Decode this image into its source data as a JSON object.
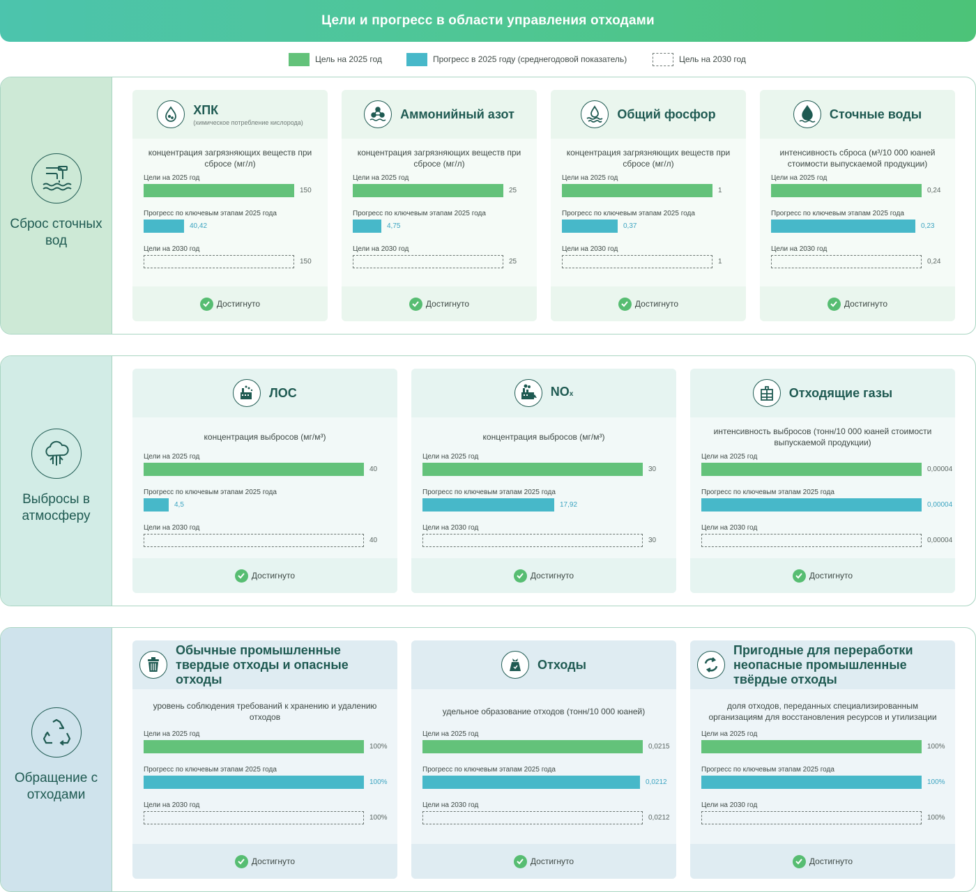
{
  "title": "Цели и прогресс в области управления отходами",
  "legend": [
    {
      "label": "Цель на 2025 год",
      "style": "green"
    },
    {
      "label": "Прогресс в 2025 году (среднегодовой показатель)",
      "style": "teal"
    },
    {
      "label": "Цель на 2030 год",
      "style": "dash"
    }
  ],
  "colors": {
    "green": "#63c27a",
    "teal": "#47b8c9",
    "dark": "#1f5a52"
  },
  "row_labels": {
    "target_2025": "Цели на 2025 год",
    "progress_2025": "Прогресс по ключевым этапам 2025 года",
    "target_2030": "Цели на 2030 год"
  },
  "status_label": "Достигнуто",
  "sections": [
    {
      "label": "Сброс сточных вод",
      "icon": "pipe-discharge-icon",
      "bg_side": "#cde9d6",
      "bg_head": "#eaf6ee",
      "bg_body": "#f5fbf7",
      "cards": [
        {
          "title": "ХПК",
          "subtitle": "(химическое потребление кислорода)",
          "icon": "water-drop-icon",
          "metric": "концентрация загрязняющих веществ при сбросе (мг/л)",
          "target_2025": "150",
          "progress_2025": "40,42",
          "target_2030": "150"
        },
        {
          "title": "Аммонийный азот",
          "subtitle": "",
          "icon": "molecule-icon",
          "metric": "концентрация загрязняющих веществ при сбросе (мг/л)",
          "target_2025": "25",
          "progress_2025": "4,75",
          "target_2030": "25"
        },
        {
          "title": "Общий фосфор",
          "subtitle": "",
          "icon": "droplet-water-icon",
          "metric": "концентрация загрязняющих веществ при сбросе (мг/л)",
          "target_2025": "1",
          "progress_2025": "0,37",
          "target_2030": "1"
        },
        {
          "title": "Сточные воды",
          "subtitle": "",
          "icon": "wastewater-drop-icon",
          "metric": "интенсивность сброса (м³/10 000 юаней стоимости выпускаемой продукции)",
          "target_2025": "0,24",
          "progress_2025": "0,23",
          "target_2030": "0,24"
        }
      ]
    },
    {
      "label": "Выбросы в атмосферу",
      "icon": "air-cloud-icon",
      "bg_side": "#d2ece6",
      "bg_head": "#e6f4f1",
      "bg_body": "#f2f9f8",
      "cards": [
        {
          "title": "ЛОС",
          "subtitle": "",
          "icon": "factory-icon",
          "metric": "концентрация выбросов (мг/м³)",
          "target_2025": "40",
          "progress_2025": "4,5",
          "target_2030": "40"
        },
        {
          "title": "NO",
          "subscript": "x",
          "subtitle": "",
          "icon": "factory-smoke-icon",
          "metric": "концентрация выбросов (мг/м³)",
          "target_2025": "30",
          "progress_2025": "17,92",
          "target_2030": "30"
        },
        {
          "title": "Отходящие газы",
          "subtitle": "",
          "icon": "building-icon",
          "metric": "интенсивность выбросов (тонн/10 000 юаней стоимости выпускаемой продукции)",
          "target_2025": "0,00004",
          "progress_2025": "0,00004",
          "target_2030": "0,00004"
        }
      ]
    },
    {
      "label": "Обращение с отходами",
      "icon": "recycle-icon",
      "bg_side": "#cfe3ec",
      "bg_head": "#dfecf2",
      "bg_body": "#eef5f8",
      "cards": [
        {
          "title": "Обычные промышленные твердые отходы и опасные отходы",
          "subtitle": "",
          "icon": "trash-bin-icon",
          "metric": "уровень соблюдения требований к хранению и удалению отходов",
          "target_2025": "100%",
          "progress_2025": "100%",
          "target_2030": "100%"
        },
        {
          "title": "Отходы",
          "subtitle": "",
          "icon": "waste-bag-icon",
          "metric": "удельное образование отходов (тонн/10 000 юаней)",
          "target_2025": "0,0215",
          "progress_2025": "0,0212",
          "target_2030": "0,0212"
        },
        {
          "title": "Пригодные для переработки неопасные промышленные твёрдые отходы",
          "subtitle": "",
          "icon": "recycle-circle-icon",
          "metric": "доля отходов, переданных специализированным организациям для восстановления ресурсов и утилизации",
          "target_2025": "100%",
          "progress_2025": "100%",
          "target_2030": "100%"
        }
      ]
    }
  ],
  "chart_data": {
    "type": "bar",
    "series": [
      {
        "name": "Цель на 2025 год",
        "values": [
          150,
          25,
          1,
          0.24,
          40,
          30,
          4e-05,
          100,
          0.0215,
          100
        ]
      },
      {
        "name": "Прогресс в 2025 году (среднегодовой показатель)",
        "values": [
          40.42,
          4.75,
          0.37,
          0.23,
          4.5,
          17.92,
          4e-05,
          100,
          0.0212,
          100
        ]
      },
      {
        "name": "Цель на 2030 год",
        "values": [
          150,
          25,
          1,
          0.24,
          40,
          30,
          4e-05,
          100,
          0.0212,
          100
        ]
      }
    ],
    "categories": [
      "ХПК",
      "Аммонийный азот",
      "Общий фосфор",
      "Сточные воды",
      "ЛОС",
      "NOx",
      "Отходящие газы",
      "Обычные промышленные твердые отходы и опасные отходы",
      "Отходы",
      "Пригодные для переработки неопасные промышленные твёрдые отходы"
    ],
    "progress_fraction": [
      0.2695,
      0.19,
      0.37,
      0.9583,
      0.1125,
      0.5973,
      1.0,
      1.0,
      0.986,
      1.0
    ]
  }
}
